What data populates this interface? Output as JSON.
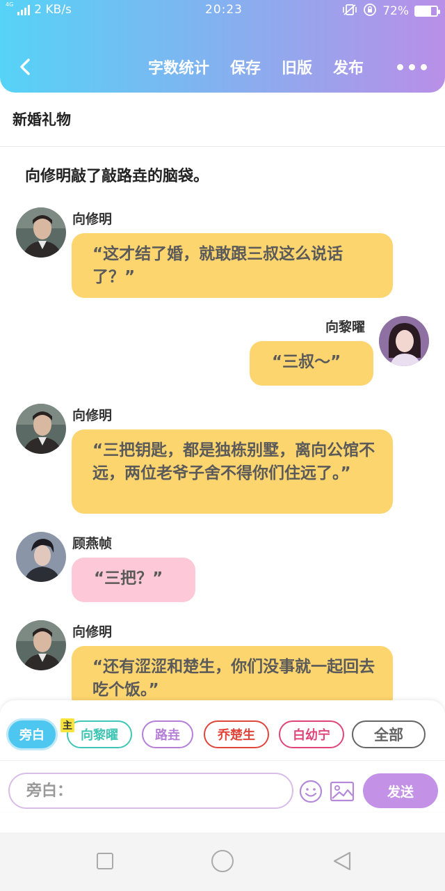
{
  "status_bar": {
    "network": "4G",
    "speed": "2 KB/s",
    "time": "20:23",
    "battery": "72%",
    "battery_level": 0.72
  },
  "toolbar": {
    "actions": [
      "字数统计",
      "保存",
      "旧版",
      "发布"
    ]
  },
  "document": {
    "title": "新婚礼物",
    "narration": "向修明敲了敲路垚的脑袋。"
  },
  "messages": [
    {
      "speaker": "向修明",
      "text": "“这才结了婚，就敢跟三叔这么说话了？”",
      "side": "left",
      "color": "yellow"
    },
    {
      "speaker": "向黎曜",
      "text": "“三叔～”",
      "side": "right",
      "color": "yellow"
    },
    {
      "speaker": "向修明",
      "text": "“三把钥匙，都是独栋别墅，离向公馆不远，两位老爷子舍不得你们住远了。”",
      "side": "left",
      "color": "yellow"
    },
    {
      "speaker": "顾燕帧",
      "text": "“三把？”",
      "side": "left",
      "color": "pink"
    },
    {
      "speaker": "向修明",
      "text": "“还有涩涩和楚生，你们没事就一起回去吃个饭。”",
      "side": "left",
      "color": "yellow"
    }
  ],
  "roles": {
    "main_tag": "主",
    "items": [
      {
        "label": "旁白",
        "color": "#4ec7f0",
        "active": true
      },
      {
        "label": "向黎曜",
        "color": "#3fc6b4"
      },
      {
        "label": "路垚",
        "color": "#b57fd8"
      },
      {
        "label": "乔楚生",
        "color": "#e0453a"
      },
      {
        "label": "白幼宁",
        "color": "#e0457a"
      },
      {
        "label": "全部",
        "color": "#666666"
      }
    ]
  },
  "composer": {
    "placeholder": "旁白：",
    "send_label": "发送",
    "emoji_icon": "smiley-icon",
    "image_icon": "image-icon"
  }
}
